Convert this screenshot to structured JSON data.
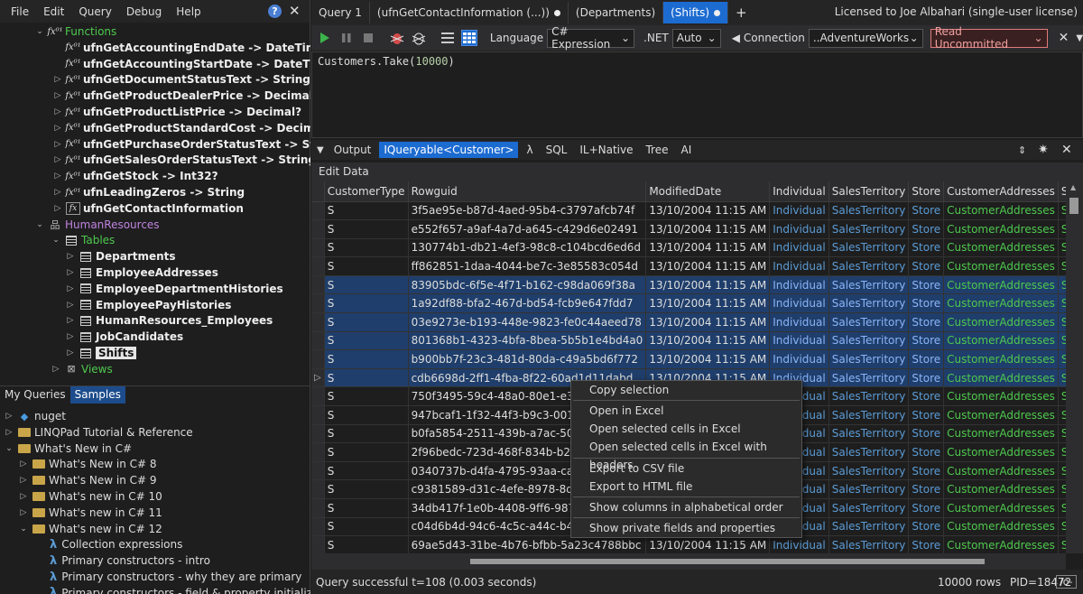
{
  "menu": [
    "File",
    "Edit",
    "Query",
    "Debug",
    "Help"
  ],
  "schema": {
    "functions_label": "Functions",
    "functions": [
      {
        "label": "ufnGetAccountingEndDate -> DateTime?",
        "expander": ""
      },
      {
        "label": "ufnGetAccountingStartDate -> DateTime?",
        "expander": ""
      },
      {
        "label": "ufnGetDocumentStatusText -> String",
        "expander": ">"
      },
      {
        "label": "ufnGetProductDealerPrice -> Decimal?",
        "expander": ">"
      },
      {
        "label": "ufnGetProductListPrice -> Decimal?",
        "expander": ">"
      },
      {
        "label": "ufnGetProductStandardCost -> Decimal?",
        "expander": ">"
      },
      {
        "label": "ufnGetPurchaseOrderStatusText -> String",
        "expander": ">"
      },
      {
        "label": "ufnGetSalesOrderStatusText -> String",
        "expander": ">"
      },
      {
        "label": "ufnGetStock -> Int32?",
        "expander": ">"
      },
      {
        "label": "ufnLeadingZeros -> String",
        "expander": ">"
      },
      {
        "label": "ufnGetContactInformation",
        "expander": ">"
      }
    ],
    "human_resources_label": "HumanResources",
    "tables_label": "Tables",
    "tables": [
      "Departments",
      "EmployeeAddresses",
      "EmployeeDepartmentHistories",
      "EmployeePayHistories",
      "HumanResources_Employees",
      "JobCandidates",
      "Shifts"
    ],
    "views_label": "Views"
  },
  "bottom_tabs": [
    "My Queries",
    "Samples"
  ],
  "samples": {
    "nuget": "nuget",
    "tutorial": "LINQPad Tutorial & Reference",
    "whats_new": "What's New in C#",
    "versions": [
      "What's New in C# 8",
      "What's New in C# 9",
      "What's new in C# 10",
      "What's new in C# 11",
      "What's new in C# 12"
    ],
    "items": [
      "Collection expressions",
      "Primary constructors - intro",
      "Primary constructors - why they are primary",
      "Primary constructors - field & property initializers"
    ]
  },
  "query_tabs": [
    {
      "label": "Query 1",
      "dirty": false
    },
    {
      "label": "(ufnGetContactInformation (...))",
      "dirty": true
    },
    {
      "label": "(Departments)",
      "dirty": false
    },
    {
      "label": "(Shifts)",
      "dirty": true
    }
  ],
  "add_tab": "+",
  "license": "Licensed to Joe Albahari (single-user license)",
  "toolbar": {
    "language_label": "Language",
    "language_value": "C# Expression",
    "net_label": ".NET",
    "net_value": "Auto",
    "connection_label": "Connection",
    "connection_value": "..AdventureWorks",
    "isolation_value": "Read Uncommitted"
  },
  "editor": {
    "code_prefix": "Customers.Take(",
    "code_number": "10000",
    "code_suffix": ")"
  },
  "output_tabs": {
    "output": "Output",
    "iqueryable": "IQueryable<Customer>",
    "lambda": "λ",
    "sql": "SQL",
    "il": "IL+Native",
    "tree": "Tree",
    "ai": "AI"
  },
  "edit_data": "Edit Data",
  "grid": {
    "columns": [
      "CustomerType",
      "Rowguid",
      "ModifiedDate",
      "Individual",
      "SalesTerritory",
      "Store",
      "CustomerAddresses",
      "Sal"
    ],
    "rows": [
      {
        "type": "S",
        "guid": "3f5ae95e-b87d-4aed-95b4-c3797afcb74f",
        "date": "13/10/2004 11:15 AM",
        "sel": false
      },
      {
        "type": "S",
        "guid": "e552f657-a9af-4a7d-a645-c429d6e02491",
        "date": "13/10/2004 11:15 AM",
        "sel": false
      },
      {
        "type": "S",
        "guid": "130774b1-db21-4ef3-98c8-c104bcd6ed6d",
        "date": "13/10/2004 11:15 AM",
        "sel": false
      },
      {
        "type": "S",
        "guid": "ff862851-1daa-4044-be7c-3e85583c054d",
        "date": "13/10/2004 11:15 AM",
        "sel": false
      },
      {
        "type": "S",
        "guid": "83905bdc-6f5e-4f71-b162-c98da069f38a",
        "date": "13/10/2004 11:15 AM",
        "sel": true
      },
      {
        "type": "S",
        "guid": "1a92df88-bfa2-467d-bd54-fcb9e647fdd7",
        "date": "13/10/2004 11:15 AM",
        "sel": true
      },
      {
        "type": "S",
        "guid": "03e9273e-b193-448e-9823-fe0c44aeed78",
        "date": "13/10/2004 11:15 AM",
        "sel": true
      },
      {
        "type": "S",
        "guid": "801368b1-4323-4bfa-8bea-5b5b1e4bd4a0",
        "date": "13/10/2004 11:15 AM",
        "sel": true
      },
      {
        "type": "S",
        "guid": "b900bb7f-23c3-481d-80da-c49a5bd6f772",
        "date": "13/10/2004 11:15 AM",
        "sel": true
      },
      {
        "type": "S",
        "guid": "cdb6698d-2ff1-4fba-8f22-60ad1d11dabd",
        "date": "13/10/2004 11:15 AM",
        "sel": true
      },
      {
        "type": "S",
        "guid": "750f3495-59c4-48a0-80e1-e37",
        "date": "",
        "sel": false
      },
      {
        "type": "S",
        "guid": "947bcaf1-1f32-44f3-b9c3-0011",
        "date": "",
        "sel": false
      },
      {
        "type": "S",
        "guid": "b0fa5854-2511-439b-a7ac-50c",
        "date": "",
        "sel": false
      },
      {
        "type": "S",
        "guid": "2f96bedc-723d-468f-834b-b2b",
        "date": "",
        "sel": false
      },
      {
        "type": "S",
        "guid": "0340737b-d4fa-4795-93aa-cae",
        "date": "",
        "sel": false
      },
      {
        "type": "S",
        "guid": "c9381589-d31c-4efe-8978-8d3",
        "date": "",
        "sel": false
      },
      {
        "type": "S",
        "guid": "34db417f-1e0b-4408-9ff6-987",
        "date": "",
        "sel": false
      },
      {
        "type": "S",
        "guid": "c04d6b4d-94c6-4c5c-a44c-b44",
        "date": "",
        "sel": false
      },
      {
        "type": "S",
        "guid": "69ae5d43-31be-4b76-bfbb-5a23c4788bbc",
        "date": "13/10/2004 11:15 AM",
        "sel": false
      }
    ],
    "link_individual": "Individual",
    "link_territory": "SalesTerritory",
    "link_store": "Store",
    "link_addresses": "CustomerAddresses",
    "link_sal": "Sal"
  },
  "context_menu": [
    "Copy selection",
    "Open in Excel",
    "Open selected cells in Excel",
    "Open selected cells in Excel with headers",
    "Export to CSV file",
    "Export to HTML file",
    "Show columns in alphabetical order",
    "Show private fields and properties"
  ],
  "status": {
    "message": "Query successful t=108  (0.003 seconds)",
    "rows": "10000 rows",
    "pid": "PID=18472",
    "badge": "/o-"
  }
}
